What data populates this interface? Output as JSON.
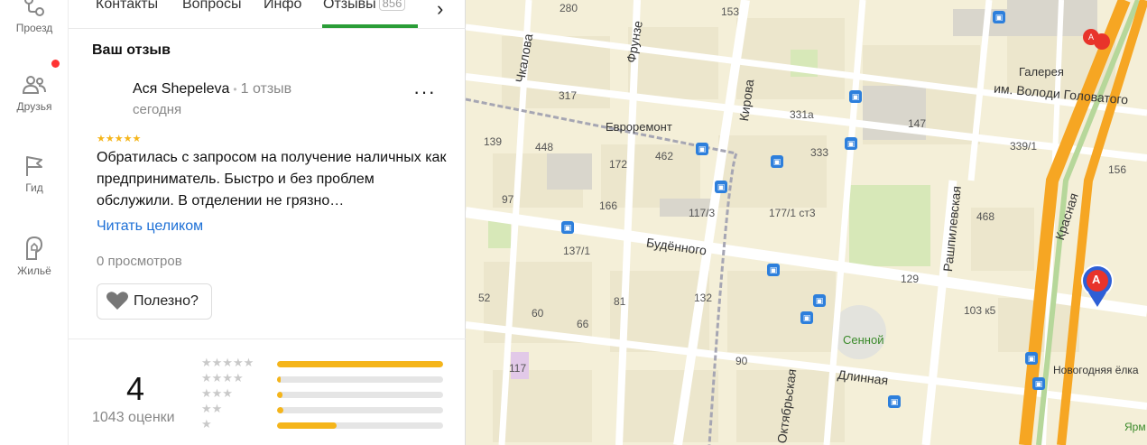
{
  "rail": {
    "items": [
      {
        "label": "Проезд",
        "icon": "route-icon"
      },
      {
        "label": "Друзья",
        "icon": "friends-icon"
      },
      {
        "label": "Гид",
        "icon": "flag-icon"
      },
      {
        "label": "Жильё",
        "icon": "housing-icon"
      }
    ]
  },
  "tabs": {
    "contacts": "Контакты",
    "questions": "Вопросы",
    "info": "Инфо",
    "reviews": "Отзывы",
    "reviews_count": "856"
  },
  "review": {
    "section_title": "Ваш отзыв",
    "author": "Ася Shepeleva",
    "author_separator": "•",
    "author_reviews": "1 отзыв",
    "date": "сегодня",
    "stars": "★★★★★",
    "text": "Обратилась с запросом на получение наличных как предприниматель. Быстро и без проблем обслужили. В отделении не грязно…",
    "read_more": "Читать целиком",
    "views": "0 просмотров",
    "useful_label": "Полезно?",
    "rating_stars": 5
  },
  "rating": {
    "value": "4",
    "count": "1043 оценки",
    "histogram": [
      {
        "stars": "★★★★★",
        "fraction": 1.0
      },
      {
        "stars": "★★★★",
        "fraction": 0.02
      },
      {
        "stars": "★★★",
        "fraction": 0.035
      },
      {
        "stars": "★★",
        "fraction": 0.04
      },
      {
        "stars": "★",
        "fraction": 0.36
      }
    ]
  },
  "map": {
    "streets": [
      "Чкалова",
      "Фрунзе",
      "Кирова",
      "Будённого",
      "Рашпилевская",
      "Красная",
      "Длинная",
      "Октябрьская",
      "им. Володи Головатого"
    ],
    "places": [
      "Евроремонт",
      "Сенной",
      "Галерея",
      "Новогодняя ёлка",
      "Ярм"
    ],
    "house_numbers": [
      "280",
      "153",
      "317",
      "139",
      "448",
      "172",
      "462",
      "331а",
      "333",
      "147",
      "339/1",
      "156",
      "97",
      "166",
      "117/3",
      "177/1 ст3",
      "468",
      "137/1",
      "129",
      "52",
      "81",
      "60",
      "66",
      "132",
      "103 к5",
      "117",
      "90",
      "60",
      "156",
      "139"
    ],
    "marker_letter": "A",
    "colors": {
      "land": "#f4efd8",
      "road": "#ffffff",
      "main_road": "#f6a623",
      "park": "#d7e8b8",
      "marker": "#e8342b"
    }
  }
}
